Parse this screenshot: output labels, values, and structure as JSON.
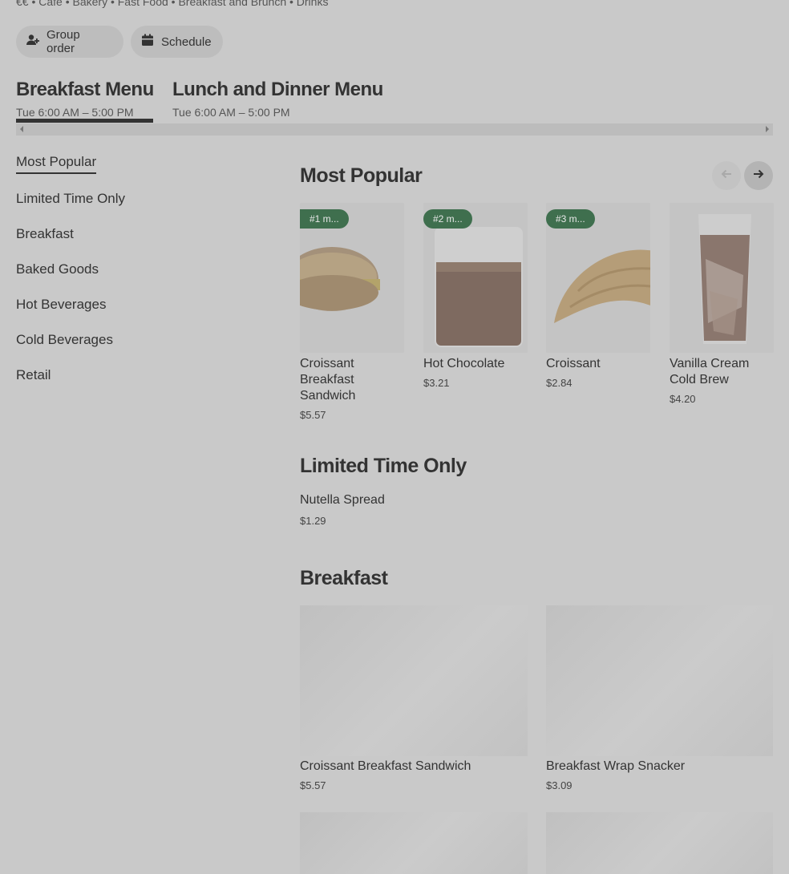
{
  "store": {
    "tags": "€€ • Café • Bakery • Fast Food • Breakfast and Brunch • Drinks",
    "actions": {
      "group_order": "Group order",
      "schedule": "Schedule"
    }
  },
  "menus": [
    {
      "title": "Breakfast Menu",
      "hours": "Tue 6:00 AM – 5:00 PM"
    },
    {
      "title": "Lunch and Dinner Menu",
      "hours": "Tue 6:00 AM – 5:00 PM"
    }
  ],
  "sidebar": {
    "items": [
      {
        "label": "Most Popular"
      },
      {
        "label": "Limited Time Only"
      },
      {
        "label": "Breakfast"
      },
      {
        "label": "Baked Goods"
      },
      {
        "label": "Hot Beverages"
      },
      {
        "label": "Cold Beverages"
      },
      {
        "label": "Retail"
      }
    ]
  },
  "most_popular": {
    "title": "Most Popular",
    "items": [
      {
        "badge": "#1 m...",
        "name": "Croissant Breakfast Sandwich",
        "price": "$5.57"
      },
      {
        "badge": "#2 m...",
        "name": "Hot Chocolate",
        "price": "$3.21"
      },
      {
        "badge": "#3 m...",
        "name": "Croissant",
        "price": "$2.84"
      },
      {
        "name": "Vanilla Cream Cold Brew",
        "price": "$4.20"
      }
    ]
  },
  "limited": {
    "title": "Limited Time Only",
    "items": [
      {
        "name": "Nutella Spread",
        "price": "$1.29"
      }
    ]
  },
  "breakfast": {
    "title": "Breakfast",
    "items": [
      {
        "name": "Croissant Breakfast Sandwich",
        "price": "$5.57"
      },
      {
        "name": "Breakfast Wrap Snacker",
        "price": "$3.09"
      }
    ]
  },
  "colors": {
    "badge": "#3f6f4e",
    "overlay_bg": "#c9c9c9"
  },
  "icons": [
    "add-person-icon",
    "calendar-icon",
    "arrow-left-icon",
    "arrow-right-icon"
  ]
}
